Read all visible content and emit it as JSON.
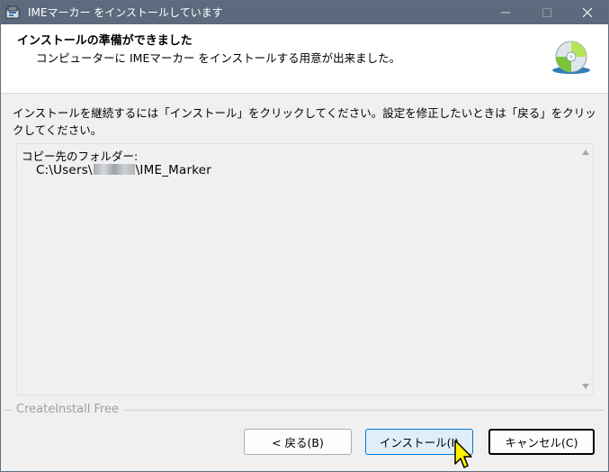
{
  "window": {
    "title": "IMEマーカー をインストールしています",
    "minimize_icon": "minimize-icon",
    "maximize_icon": "maximize-icon",
    "close_icon": "close-icon"
  },
  "header": {
    "title": "インストールの準備ができました",
    "subtitle": "コンピューターに IMEマーカー をインストールする用意が出来ました。",
    "icon": "cd-disc-icon"
  },
  "instruction": "インストールを継続するには「インストール」をクリックしてください。設定を修正したいときは「戻る」をクリックしてください。",
  "info": {
    "label": "コピー先のフォルダー:",
    "path_prefix": "C:\\Users\\",
    "path_suffix": "\\IME_Marker"
  },
  "brand": "CreateInstall Free",
  "buttons": {
    "back": "< 戻る(B)",
    "install": "インストール(I)",
    "cancel": "キャンセル(C)"
  },
  "colors": {
    "titlebar": "#5b6b7d",
    "accent": "#0078d4",
    "cursor": "#fff200"
  }
}
